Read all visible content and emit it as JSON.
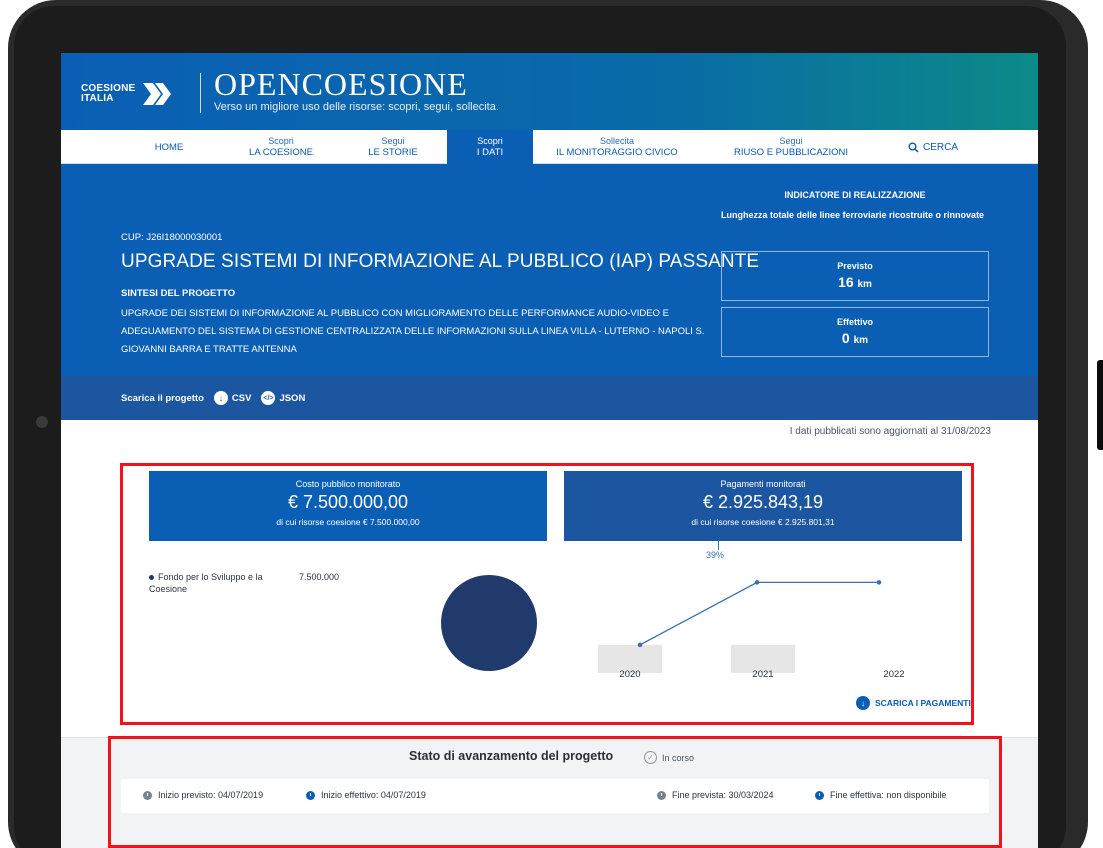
{
  "header": {
    "logo_line1": "COESIONE",
    "logo_line2": "ITALIA",
    "brand_title": "OPENCOESIONE",
    "brand_subtitle": "Verso un migliore uso delle risorse: scopri, segui, sollecita."
  },
  "nav": {
    "items": [
      {
        "pre": "",
        "label": "HOME"
      },
      {
        "pre": "Scopri",
        "label": "LA COESIONE"
      },
      {
        "pre": "Segui",
        "label": "LE STORIE"
      },
      {
        "pre": "Scopri",
        "label": "I DATI"
      },
      {
        "pre": "Sollecita",
        "label": "IL MONITORAGGIO CIVICO"
      },
      {
        "pre": "Segui",
        "label": "RIUSO E PUBBLICAZIONI"
      }
    ],
    "search_label": "CERCA"
  },
  "project": {
    "cup": "CUP: J26I18000030001",
    "title": "UPGRADE SISTEMI DI INFORMAZIONE AL PUBBLICO (IAP) PASSANTE",
    "sintesi_label": "SINTESI DEL PROGETTO",
    "sintesi_text": "UPGRADE DEI SISTEMI DI INFORMAZIONE AL PUBBLICO CON MIGLIORAMENTO DELLE PERFORMANCE AUDIO-VIDEO E ADEGUAMENTO DEL SISTEMA DI GESTIONE CENTRALIZZATA DELLE INFORMAZIONI SULLA LINEA VILLA - LUTERNO - NAPOLI S. GIOVANNI BARRA E TRATTE ANTENNA"
  },
  "indicator": {
    "title": "INDICATORE DI REALIZZAZIONE",
    "description": "Lunghezza totale delle linee ferroviarie ricostruite o rinnovate",
    "previsto_label": "Previsto",
    "previsto_value": "16",
    "previsto_unit": "km",
    "effettivo_label": "Effettivo",
    "effettivo_value": "0",
    "effettivo_unit": "km"
  },
  "download": {
    "label": "Scarica il progetto",
    "csv": "CSV",
    "json": "JSON",
    "csv_icon": "download-icon",
    "json_icon": "code-icon"
  },
  "updated_note": "I dati pubblicati sono aggiornati al 31/08/2023",
  "finance": {
    "costo_label": "Costo pubblico monitorato",
    "costo_value": "€ 7.500.000,00",
    "costo_sub": "di cui risorse coesione € 7.500.000,00",
    "pagamenti_label": "Pagamenti monitorati",
    "pagamenti_value": "€ 2.925.843,19",
    "pagamenti_sub": "di cui risorse coesione € 2.925.801,31",
    "percent": "39%",
    "legend_name": "Fondo per lo Sviluppo e la Coesione",
    "legend_value": "7.500.000",
    "scarica_pagamenti": "SCARICA I PAGAMENTI"
  },
  "chart_data": [
    {
      "type": "pie",
      "categories": [
        "Fondo per lo Sviluppo e la Coesione"
      ],
      "values": [
        7500000
      ],
      "colors": [
        "#1f3a6b"
      ]
    },
    {
      "type": "bar",
      "categories": [
        "2020",
        "2021",
        "2022"
      ],
      "series": [
        {
          "type": "bar",
          "values": [
            0.9,
            0.9,
            0
          ]
        },
        {
          "type": "line",
          "values": [
            0.9,
            2.9,
            2.9
          ]
        }
      ],
      "colors": {
        "bar": "#e6e6e6",
        "line": "#3a6fb0"
      }
    }
  ],
  "stato": {
    "title": "Stato di avanzamento del progetto",
    "status": "In corso",
    "inizio_previsto": "Inizio previsto: 04/07/2019",
    "inizio_effettivo": "Inizio effettivo: 04/07/2019",
    "fine_prevista": "Fine prevista: 30/03/2024",
    "fine_effettiva": "Fine effettiva: non disponibile"
  },
  "colors": {
    "primary": "#0a5fb5",
    "secondary": "#1c56a0",
    "highlight": "#f2121b",
    "pie": "#1f3a6b"
  }
}
